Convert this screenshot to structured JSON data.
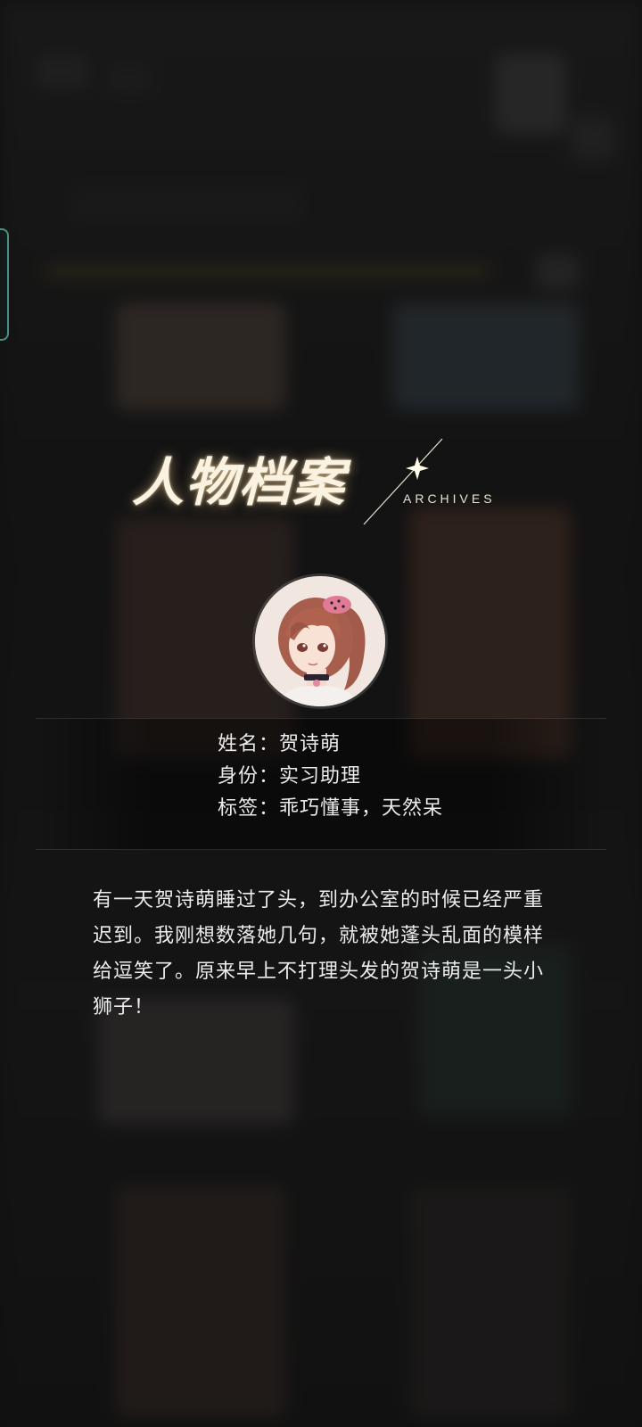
{
  "title": {
    "main": "人物档案",
    "sub": "ARCHIVES"
  },
  "profile": {
    "name_label": "姓名：",
    "name_value": "贺诗萌",
    "identity_label": "身份：",
    "identity_value": "实习助理",
    "tags_label": "标签：",
    "tags_value": "乖巧懂事，天然呆"
  },
  "description": "有一天贺诗萌睡过了头，到办公室的时候已经严重迟到。我刚想数落她几句，就被她蓬头乱面的模样给逗笑了。原来早上不打理头发的贺诗萌是一头小狮子！",
  "colors": {
    "accent_teal": "#4a8f84",
    "title_glow": "#fbf3e1"
  }
}
